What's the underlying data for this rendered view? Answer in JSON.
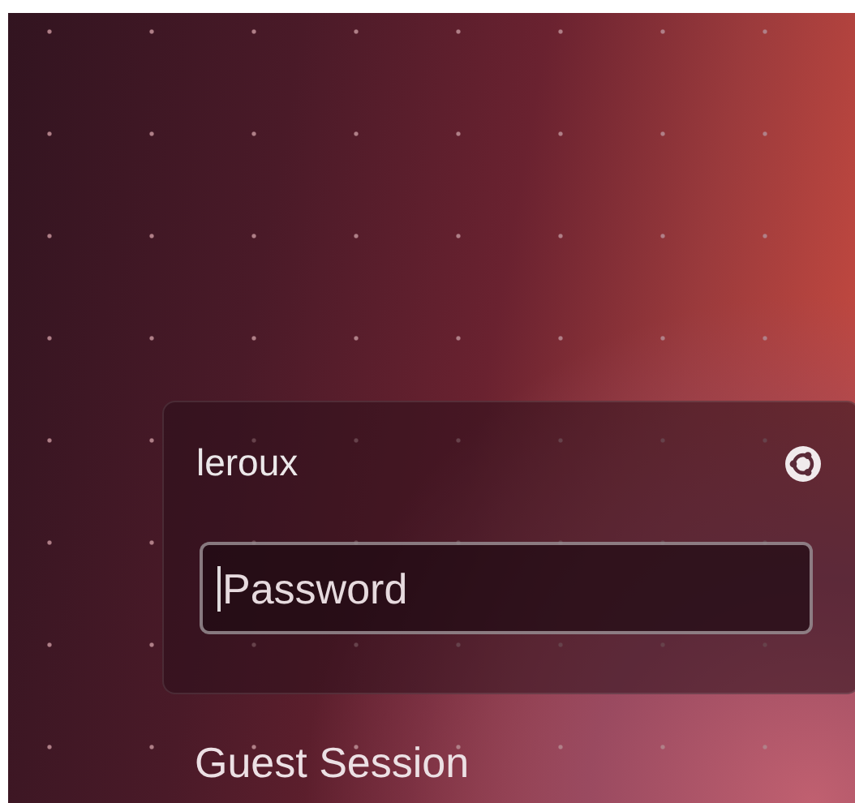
{
  "login_card": {
    "username": "leroux",
    "password_field": {
      "placeholder": "Password",
      "focused": true
    }
  },
  "other_users": [
    {
      "label": "Guest Session"
    }
  ]
}
